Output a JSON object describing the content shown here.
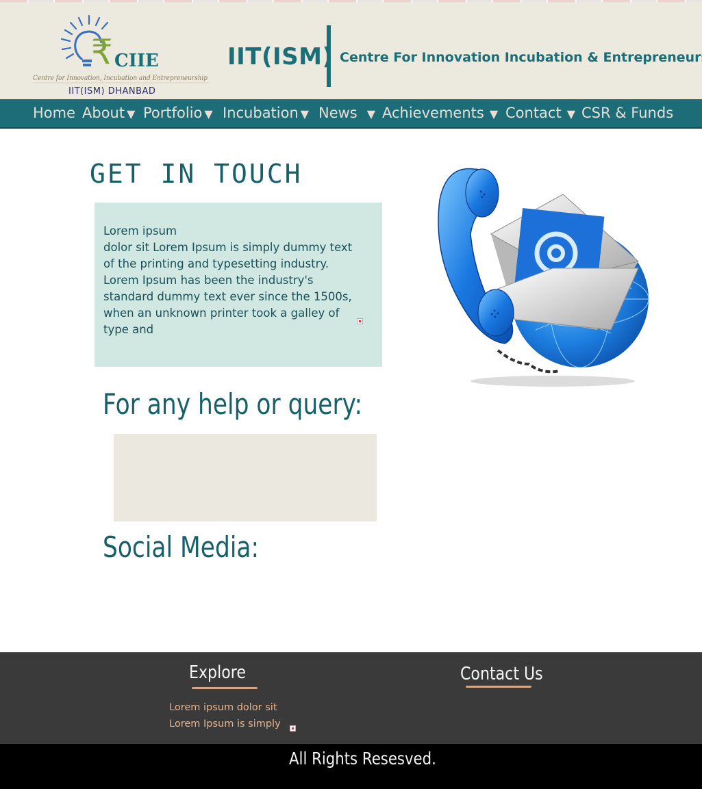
{
  "header": {
    "logo": {
      "name": "CIIE",
      "tagline": "Centre for Innovation, Incubation and Entrepreneurship",
      "place": "IIT(ISM) DHANBAD"
    },
    "brand": "IIT(ISM)",
    "centre_title": "Centre For Innovation Incubation & Entrepreneurship"
  },
  "nav": [
    {
      "label": "Home",
      "arrow": ""
    },
    {
      "label": "About",
      "arrow": "▼"
    },
    {
      "label": "Portfolio",
      "arrow": "▼"
    },
    {
      "label": "Incubation",
      "arrow": "▼"
    },
    {
      "label": "News",
      "arrow": "▼"
    },
    {
      "label": "Achievements",
      "arrow": "▼"
    },
    {
      "label": "Contact",
      "arrow": "▼"
    },
    {
      "label": "CSR & Funds",
      "arrow": ""
    }
  ],
  "main": {
    "title": "GET IN TOUCH",
    "lorem": "Lorem ipsum\ndolor sit Lorem Ipsum is simply dummy text of the printing and typesetting industry. Lorem Ipsum has been the industry's standard dummy text ever since the 1500s, when an unknown printer took a galley of type and",
    "help_title": "For any help or query:",
    "social_title": "Social Media:"
  },
  "footer": {
    "explore_title": "Explore",
    "explore_links": [
      "Lorem ipsum dolor sit",
      "Lorem Ipsum is simply"
    ],
    "contact_title": "Contact Us",
    "rights": "All Rights Resesved."
  },
  "colors": {
    "nav_bg": "#1c6d77",
    "nav_text": "#e9ddd5",
    "heading": "#175f69",
    "header_bg": "#ece9df",
    "lorem_bg": "#d1e8e2",
    "footer_bg": "#3a3a3a",
    "footer_link": "#e7b48d",
    "accent_blue": "#1e7fe0"
  },
  "icons": [
    "rupee-bulb-logo-icon",
    "phone-email-globe-icon",
    "broken-image-icon"
  ]
}
